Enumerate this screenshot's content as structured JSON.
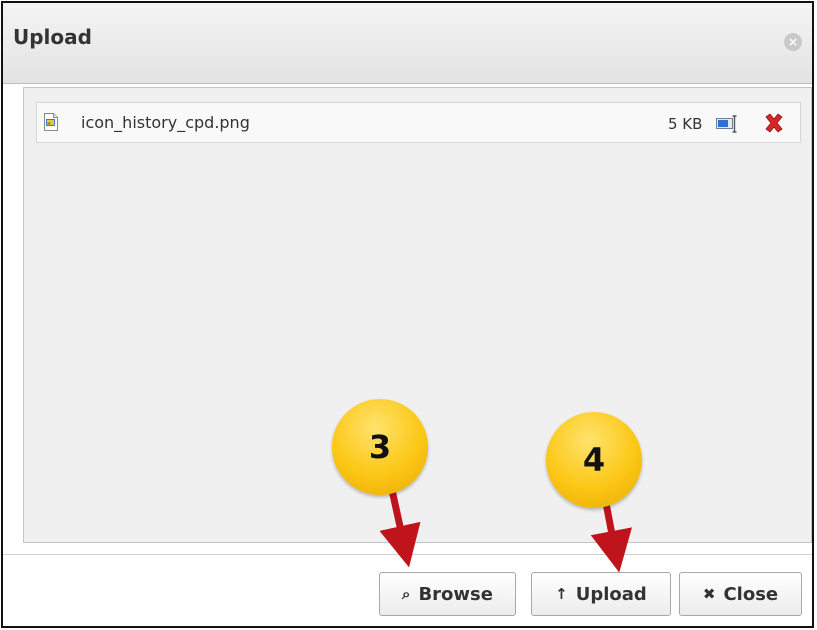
{
  "dialog": {
    "title": "Upload",
    "close_glyph": "×"
  },
  "files": [
    {
      "name": "icon_history_cpd.png",
      "size": "5 KB",
      "icon": "image-file-icon",
      "preview_icon": "preview-icon",
      "remove_icon": "remove-icon"
    }
  ],
  "buttons": {
    "browse": {
      "label": "Browse",
      "icon": "search-icon",
      "glyph": "⌕"
    },
    "upload": {
      "label": "Upload",
      "icon": "arrow-up-icon",
      "glyph": "↑"
    },
    "close": {
      "label": "Close",
      "icon": "close-icon",
      "glyph": "✖"
    }
  },
  "callouts": [
    {
      "label": "3",
      "target": "browse"
    },
    {
      "label": "4",
      "target": "upload"
    }
  ],
  "colors": {
    "badge": "#fcc715",
    "arrow": "#c0141c",
    "remove": "#d6262a"
  }
}
